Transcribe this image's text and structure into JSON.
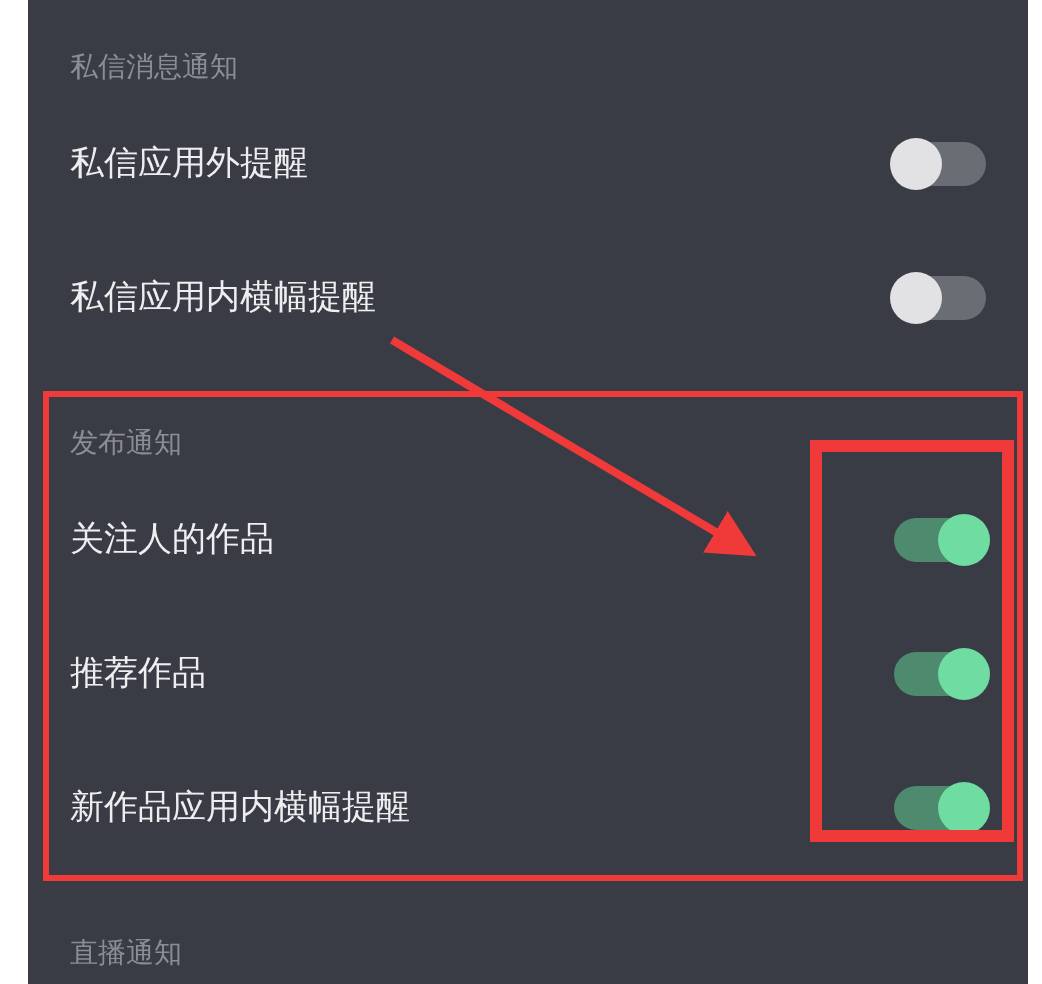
{
  "sections": [
    {
      "title": "私信消息通知",
      "rows": [
        {
          "label": "私信应用外提醒",
          "on": false
        },
        {
          "label": "私信应用内横幅提醒",
          "on": false
        }
      ]
    },
    {
      "title": "发布通知",
      "rows": [
        {
          "label": "关注人的作品",
          "on": true
        },
        {
          "label": "推荐作品",
          "on": true
        },
        {
          "label": "新作品应用内横幅提醒",
          "on": true
        }
      ]
    },
    {
      "title": "直播通知"
    }
  ]
}
